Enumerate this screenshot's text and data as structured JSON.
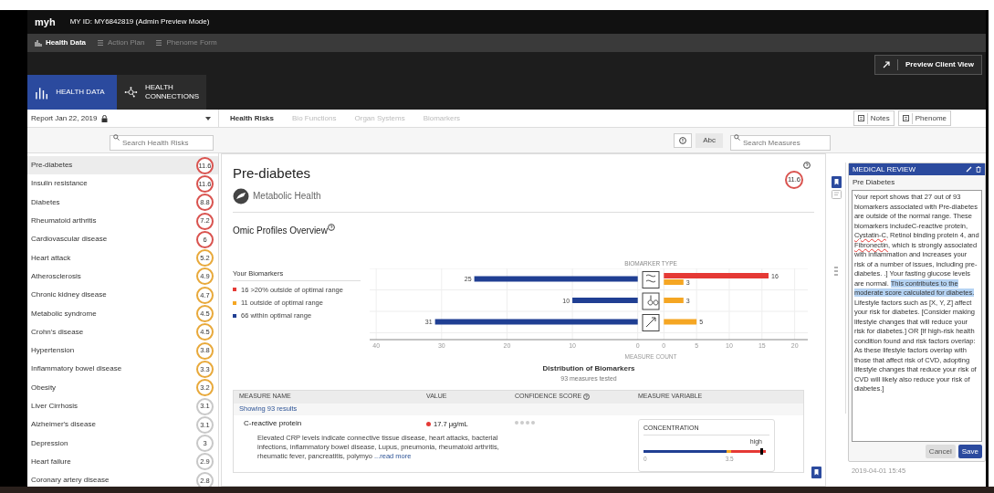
{
  "topbar": {
    "logo": "myh",
    "user_id": "MY ID: MY6842819 (Admin Preview Mode)"
  },
  "nav": [
    {
      "label": "Health Data",
      "selected": true
    },
    {
      "label": "Action Plan",
      "selected": false
    },
    {
      "label": "Phenome Form",
      "selected": false
    }
  ],
  "preview_button": "Preview Client View",
  "tiles": [
    {
      "label": "HEALTH DATA",
      "selected": true,
      "kind": "chart"
    },
    {
      "label": "HEALTH CONNECTIONS",
      "selected": false,
      "kind": "network"
    }
  ],
  "report_select": {
    "value": "Report Jan 22, 2019",
    "locked": true
  },
  "tabs": [
    {
      "label": "Health Risks",
      "selected": true
    },
    {
      "label": "Bio Functions",
      "selected": false
    },
    {
      "label": "Organ Systems",
      "selected": false
    },
    {
      "label": "Biomarkers",
      "selected": false
    }
  ],
  "side_buttons": [
    "Notes",
    "Phenome"
  ],
  "risk_search": {
    "placeholder": "Search Health Risks"
  },
  "measure_toolbar": {
    "view_button": "Abc",
    "search_placeholder": "Search Measures"
  },
  "risks": [
    {
      "name": "Pre-diabetes",
      "score": "11.6",
      "color": "#d9534f",
      "selected": true
    },
    {
      "name": "Insulin resistance",
      "score": "11.6",
      "color": "#d9534f",
      "selected": false
    },
    {
      "name": "Diabetes",
      "score": "8.8",
      "color": "#d9534f",
      "selected": false
    },
    {
      "name": "Rheumatoid arthritis",
      "score": "7.2",
      "color": "#d9534f",
      "selected": false
    },
    {
      "name": "Cardiovascular disease",
      "score": "6",
      "color": "#d9534f",
      "selected": false
    },
    {
      "name": "Heart attack",
      "score": "5.2",
      "color": "#e8a93b",
      "selected": false
    },
    {
      "name": "Atherosclerosis",
      "score": "4.9",
      "color": "#e8a93b",
      "selected": false
    },
    {
      "name": "Chronic kidney disease",
      "score": "4.7",
      "color": "#e8a93b",
      "selected": false
    },
    {
      "name": "Metabolic syndrome",
      "score": "4.5",
      "color": "#e8a93b",
      "selected": false
    },
    {
      "name": "Crohn's disease",
      "score": "4.5",
      "color": "#e8a93b",
      "selected": false
    },
    {
      "name": "Hypertension",
      "score": "3.8",
      "color": "#e8a93b",
      "selected": false
    },
    {
      "name": "Inflammatory bowel disease",
      "score": "3.3",
      "color": "#e8a93b",
      "selected": false
    },
    {
      "name": "Obesity",
      "score": "3.2",
      "color": "#e8a93b",
      "selected": false
    },
    {
      "name": "Liver Cirrhosis",
      "score": "3.1",
      "color": "#c8c8c8",
      "selected": false
    },
    {
      "name": "Alzheimer's disease",
      "score": "3.1",
      "color": "#c8c8c8",
      "selected": false
    },
    {
      "name": "Depression",
      "score": "3",
      "color": "#c8c8c8",
      "selected": false
    },
    {
      "name": "Heart failure",
      "score": "2.9",
      "color": "#c8c8c8",
      "selected": false
    },
    {
      "name": "Coronary artery disease",
      "score": "2.8",
      "color": "#c8c8c8",
      "selected": false
    }
  ],
  "detail": {
    "title": "Pre-diabetes",
    "category": "Metabolic Health",
    "score": {
      "text": "11.6",
      "color": "#d9534f"
    },
    "section_title": "Omic Profiles Overview",
    "legend_title": "Your Biomarkers",
    "chart_header": "BIOMARKER TYPE",
    "chart_axis_title": "MEASURE COUNT",
    "chart_title": "Distribution of Biomarkers",
    "chart_subtitle": "93 measures tested",
    "within_chart": {
      "chart_data": {
        "type": "bar",
        "orientation": "horizontal",
        "categories": [
          null,
          null,
          null
        ],
        "data_labels": true,
        "grid": true,
        "series": [
          {
            "name": "66 within optimal range",
            "color": "#203f93",
            "values": [
              25,
              10,
              31
            ]
          }
        ],
        "xticks": [
          40,
          30,
          20,
          10,
          0
        ],
        "xlim": [
          41,
          -0.6
        ]
      }
    },
    "outside_chart": {
      "chart_data": {
        "type": "bar",
        "orientation": "horizontal",
        "categories": [
          null,
          null,
          null
        ],
        "data_labels": true,
        "grid": true,
        "series": [
          {
            "name": "16 >20% outside of optimal range",
            "color": "#e53935",
            "values": [
              16,
              null,
              null
            ]
          },
          {
            "name": "11 outside of optimal range",
            "color": "#f5a623",
            "values": [
              3,
              3,
              5
            ]
          }
        ],
        "xticks": [
          0,
          5,
          10,
          15,
          20
        ],
        "xlim": [
          -0.6,
          22
        ]
      }
    },
    "table": {
      "columns": [
        "MEASURE NAME",
        "VALUE",
        "CONFIDENCE SCORE",
        "MEASURE VARIABLE"
      ],
      "count": "Showing 93 results",
      "rows": [
        {
          "name": "C-reactive protein",
          "value": {
            "text": "17.7 μg/mL",
            "color": "#e53935"
          },
          "stars": 0,
          "description": "Elevated CRP levels indicate connective tissue disease, heart attacks, bacterial infections, inflammatory bowel disease, Lupus, pneumonia, rheumatoid arthritis, rheumatic fever, pancreatitis, polymyo",
          "read_more": "...read more",
          "variable": {
            "title": "CONCENTRATION",
            "zone": "high",
            "level": 0.97,
            "min": "0",
            "tick": "3.5"
          }
        }
      ]
    }
  },
  "review": {
    "title": "MEDICAL REVIEW",
    "subject": "Pre Diabetes",
    "text": [
      {
        "kind": "plain",
        "text": "Your report shows that 27 out of 93 biomarkers associated with Pre-diabetes are outside of the normal range. These biomarkers includeC-reactive protein, "
      },
      {
        "kind": "misspelled",
        "text": "Cystatin-C"
      },
      {
        "kind": "plain",
        "text": ", Retinol binding protein 4, and "
      },
      {
        "kind": "misspelled",
        "text": "Fibronectin"
      },
      {
        "kind": "plain",
        "text": ", which is strongly associated with inflammation and increases your risk of a number of issues, including pre-diabetes. .] Your fasting glucose levels are normal. "
      },
      {
        "kind": "selected",
        "text": "This contributes to the moderate score calculated for diabetes."
      },
      {
        "kind": "plain",
        "text": " Lifestyle factors such as [X, Y, Z] affect your risk for diabetes. [Consider making lifestyle changes that will reduce your risk for diabetes.] OR [If high-risk health condition found and risk factors overlap: As these lifestyle factors overlap with those that affect risk of CVD, adopting lifestyle changes that reduce your risk of CVD will likely also reduce your risk of diabetes.]"
      }
    ],
    "buttons": [
      "Cancel",
      "Save"
    ],
    "timestamp": "2019-04-01 15:45"
  }
}
